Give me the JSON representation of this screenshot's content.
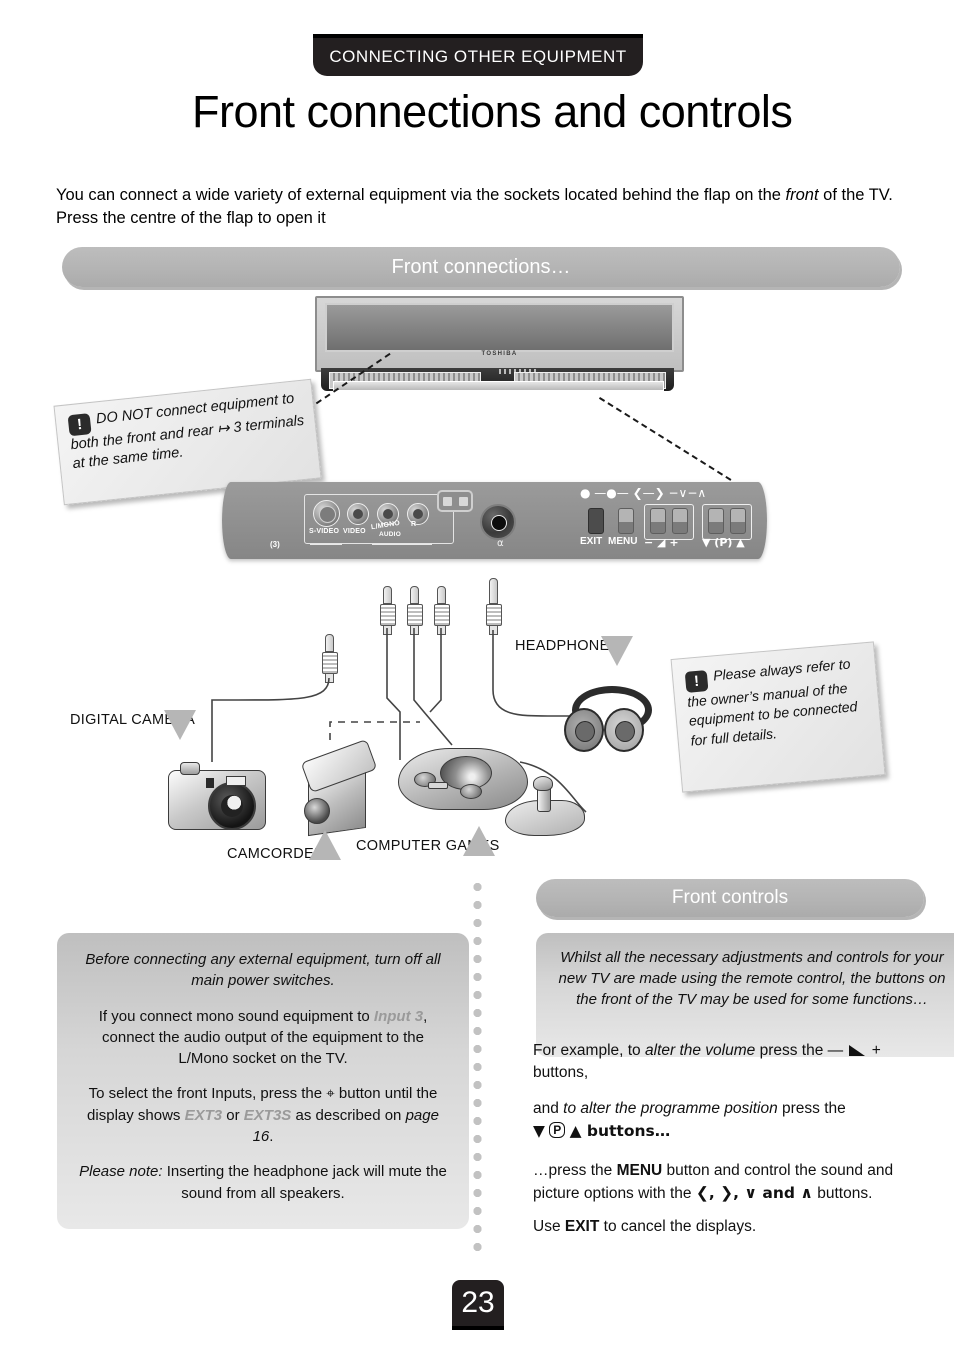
{
  "header": {
    "section_tab": "CONNECTING OTHER EQUIPMENT",
    "title": "Front connections and controls"
  },
  "intro": {
    "text_part1": "You can connect a wide variety of external equipment via the sockets located behind the flap on the ",
    "text_italic": "front",
    "text_part2": " of the TV. Press the centre of the flap to open it"
  },
  "bars": {
    "front_connections": "Front connections…",
    "front_controls": "Front controls"
  },
  "tv": {
    "brand": "TOSHIBA"
  },
  "panel": {
    "labels": {
      "s_video": "S-VIDEO",
      "video": "VIDEO",
      "l_mono": "L/MONO",
      "r": "R",
      "audio": "AUDIO",
      "input_number": "(3)",
      "exit": "EXIT",
      "menu": "MENU",
      "volume": "− ◢ +",
      "programme": "▼ (P) ▲"
    },
    "top_glyphs": "● —●— ❮—❯ −∨−∧"
  },
  "diagram_labels": {
    "digital_camera": "DIGITAL CAMERA",
    "camcorder": "CAMCORDER",
    "computer_games": "COMPUTER GAMES",
    "headphones": "HEADPHONES"
  },
  "notes": {
    "do_not": {
      "icon": "!",
      "text": "DO NOT connect equipment to both the front and rear ↦ 3 terminals at the same time."
    },
    "refer": {
      "icon": "!",
      "text": "Please always refer to the owner’s manual of the equipment to be connected for full details."
    }
  },
  "box_before": {
    "p1": "Before connecting any external equipment, turn off all main power switches.",
    "p2_a": "If you connect mono sound equipment to ",
    "p2_accent": "Input 3",
    "p2_b": ", connect the audio output of the equipment to the L/Mono socket on the TV.",
    "p3_a": "To select the front Inputs, press the ",
    "p3_icon": "input-select-icon",
    "p3_b": " button until the display shows ",
    "p3_accent1": "EXT3",
    "p3_c": " or ",
    "p3_accent2": "EXT3S",
    "p3_d": " as described on ",
    "p3_page": "page 16",
    "p3_e": ".",
    "p4_label": "Please note:",
    "p4_text": " Inserting the headphone jack will mute the sound from all speakers."
  },
  "box_whilst": {
    "text": "Whilst all the necessary adjustments and controls for your new TV are made using the remote control, the buttons on the front of the TV may be used for some functions…"
  },
  "instructions": {
    "i1_a": "For example, to ",
    "i1_italic": "alter the volume",
    "i1_b": " press the — ",
    "i1_c": " + buttons,",
    "i2_a": "and ",
    "i2_italic": "to alter the programme position",
    "i2_b": " press the",
    "i2_c": "▼",
    "i2_p": "P",
    "i2_d": "▲ buttons…",
    "i3_a": "…press the ",
    "i3_bold": "MENU",
    "i3_b": " button and control the sound and picture options with the ",
    "i3_glyphs": "❮, ❯, ∨ and ∧",
    "i3_c": " buttons.",
    "i4_a": "Use ",
    "i4_bold": "EXIT",
    "i4_b": " to cancel the displays."
  },
  "footer": {
    "page_number": "23"
  },
  "colors": {
    "tab_background": "#231f20",
    "pill_gray": "#b4b4b4",
    "box_gray": "#d6d6d6",
    "accent_gray": "#9a9a9a",
    "panel_gray": "#8e8e8e"
  }
}
